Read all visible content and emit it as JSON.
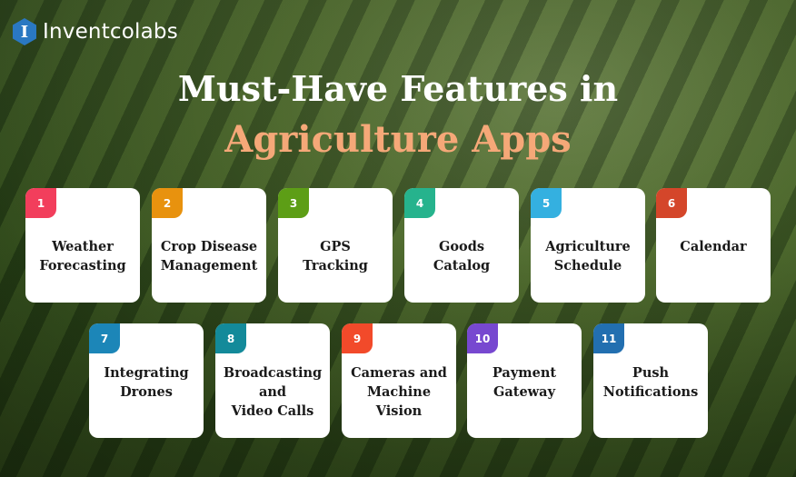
{
  "brand": {
    "logo_letter": "I",
    "name": "Inventcolabs",
    "logo_color": "#2a78c2"
  },
  "title": {
    "line1": "Must-Have Features in",
    "line2": "Agriculture Apps",
    "line1_color": "#ffffff",
    "line2_color": "#f5a878"
  },
  "features": [
    {
      "number": "1",
      "label": "Weather\nForecasting",
      "color": "#f23e5c"
    },
    {
      "number": "2",
      "label": "Crop Disease\nManagement",
      "color": "#e8920e"
    },
    {
      "number": "3",
      "label": "GPS\nTracking",
      "color": "#5d9e16"
    },
    {
      "number": "4",
      "label": "Goods\nCatalog",
      "color": "#26b38d"
    },
    {
      "number": "5",
      "label": "Agriculture\nSchedule",
      "color": "#34b0e0"
    },
    {
      "number": "6",
      "label": "Calendar",
      "color": "#d4462a"
    },
    {
      "number": "7",
      "label": "Integrating\nDrones",
      "color": "#1c86b8"
    },
    {
      "number": "8",
      "label": "Broadcasting\nand\nVideo Calls",
      "color": "#138a9a"
    },
    {
      "number": "9",
      "label": "Cameras and\nMachine\nVision",
      "color": "#f24a2a"
    },
    {
      "number": "10",
      "label": "Payment\nGateway",
      "color": "#7748d0"
    },
    {
      "number": "11",
      "label": "Push\nNotifications",
      "color": "#226fb0"
    }
  ]
}
